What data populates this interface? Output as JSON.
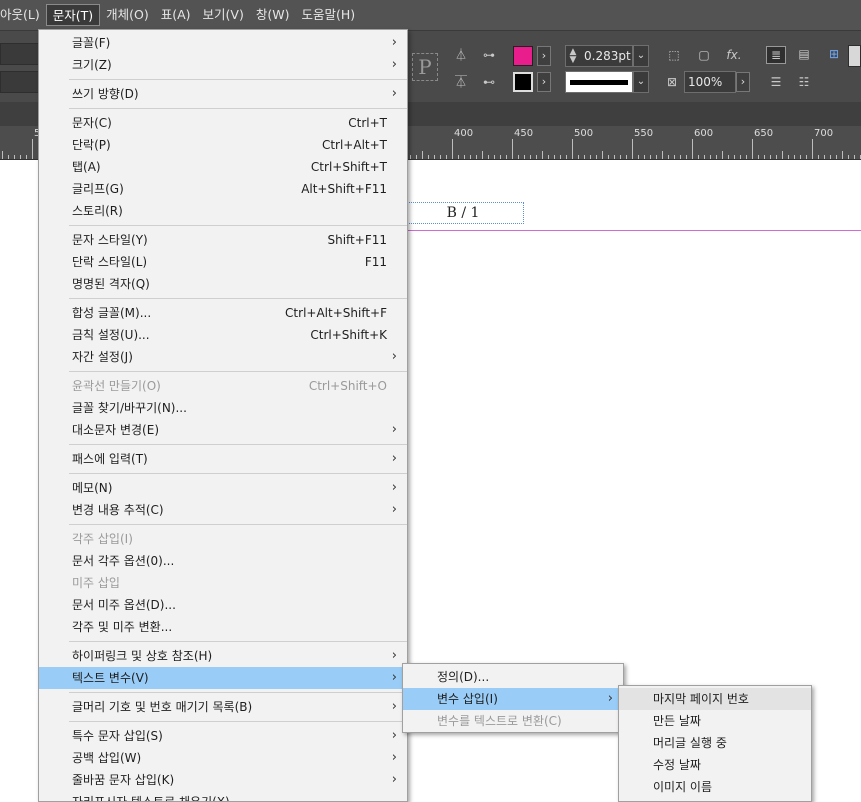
{
  "menubar": {
    "items": [
      "아웃(L)",
      "문자(T)",
      "개체(O)",
      "표(A)",
      "보기(V)",
      "창(W)",
      "도움말(H)"
    ]
  },
  "control": {
    "stroke_weight": "0.283pt",
    "opacity": "100%",
    "fill_color": "#e91e8c",
    "stroke_color": "#000000",
    "fx_label": "fx.",
    "placeholder_glyph": "P"
  },
  "ruler": {
    "labels": [
      "5",
      "400",
      "450",
      "500",
      "550",
      "600",
      "650",
      "700"
    ]
  },
  "document": {
    "page_marker": "B / 1"
  },
  "main_menu": {
    "groups": [
      [
        {
          "label": "글꼴(F)",
          "shortcut": "",
          "submenu": true,
          "disabled": false
        },
        {
          "label": "크기(Z)",
          "shortcut": "",
          "submenu": true,
          "disabled": false
        }
      ],
      [
        {
          "label": "쓰기 방향(D)",
          "shortcut": "",
          "submenu": true,
          "disabled": false
        }
      ],
      [
        {
          "label": "문자(C)",
          "shortcut": "Ctrl+T",
          "submenu": false,
          "disabled": false
        },
        {
          "label": "단락(P)",
          "shortcut": "Ctrl+Alt+T",
          "submenu": false,
          "disabled": false
        },
        {
          "label": "탭(A)",
          "shortcut": "Ctrl+Shift+T",
          "submenu": false,
          "disabled": false
        },
        {
          "label": "글리프(G)",
          "shortcut": "Alt+Shift+F11",
          "submenu": false,
          "disabled": false
        },
        {
          "label": "스토리(R)",
          "shortcut": "",
          "submenu": false,
          "disabled": false
        }
      ],
      [
        {
          "label": "문자 스타일(Y)",
          "shortcut": "Shift+F11",
          "submenu": false,
          "disabled": false
        },
        {
          "label": "단락 스타일(L)",
          "shortcut": "F11",
          "submenu": false,
          "disabled": false
        },
        {
          "label": "명명된 격자(Q)",
          "shortcut": "",
          "submenu": false,
          "disabled": false
        }
      ],
      [
        {
          "label": "합성 글꼴(M)...",
          "shortcut": "Ctrl+Alt+Shift+F",
          "submenu": false,
          "disabled": false
        },
        {
          "label": "금칙 설정(U)...",
          "shortcut": "Ctrl+Shift+K",
          "submenu": false,
          "disabled": false
        },
        {
          "label": "자간 설정(J)",
          "shortcut": "",
          "submenu": true,
          "disabled": false
        }
      ],
      [
        {
          "label": "윤곽선 만들기(O)",
          "shortcut": "Ctrl+Shift+O",
          "submenu": false,
          "disabled": true
        },
        {
          "label": "글꼴 찾기/바꾸기(N)...",
          "shortcut": "",
          "submenu": false,
          "disabled": false
        },
        {
          "label": "대소문자 변경(E)",
          "shortcut": "",
          "submenu": true,
          "disabled": false
        }
      ],
      [
        {
          "label": "패스에 입력(T)",
          "shortcut": "",
          "submenu": true,
          "disabled": false
        }
      ],
      [
        {
          "label": "메모(N)",
          "shortcut": "",
          "submenu": true,
          "disabled": false
        },
        {
          "label": "변경 내용 추적(C)",
          "shortcut": "",
          "submenu": true,
          "disabled": false
        }
      ],
      [
        {
          "label": "각주 삽입(I)",
          "shortcut": "",
          "submenu": false,
          "disabled": true
        },
        {
          "label": "문서 각주 옵션(0)...",
          "shortcut": "",
          "submenu": false,
          "disabled": false
        },
        {
          "label": "미주 삽입",
          "shortcut": "",
          "submenu": false,
          "disabled": true
        },
        {
          "label": "문서 미주 옵션(D)...",
          "shortcut": "",
          "submenu": false,
          "disabled": false
        },
        {
          "label": "각주 및 미주 변환...",
          "shortcut": "",
          "submenu": false,
          "disabled": false
        }
      ],
      [
        {
          "label": "하이퍼링크 및 상호 참조(H)",
          "shortcut": "",
          "submenu": true,
          "disabled": false
        },
        {
          "label": "텍스트 변수(V)",
          "shortcut": "",
          "submenu": true,
          "disabled": false,
          "highlighted": true
        }
      ],
      [
        {
          "label": "글머리 기호 및 번호 매기기 목록(B)",
          "shortcut": "",
          "submenu": true,
          "disabled": false
        }
      ],
      [
        {
          "label": "특수 문자 삽입(S)",
          "shortcut": "",
          "submenu": true,
          "disabled": false
        },
        {
          "label": "공백 삽입(W)",
          "shortcut": "",
          "submenu": true,
          "disabled": false
        },
        {
          "label": "줄바꿈 문자 삽입(K)",
          "shortcut": "",
          "submenu": true,
          "disabled": false
        },
        {
          "label": "자리표시자 텍스트로 채우기(X)",
          "shortcut": "",
          "submenu": false,
          "disabled": false
        }
      ]
    ]
  },
  "sub_menu": {
    "items": [
      {
        "label": "정의(D)...",
        "submenu": false,
        "disabled": false
      },
      {
        "label": "변수 삽입(I)",
        "submenu": true,
        "disabled": false,
        "highlighted": true
      },
      {
        "label": "변수를 텍스트로 변환(C)",
        "submenu": false,
        "disabled": true
      }
    ]
  },
  "subsub_menu": {
    "items": [
      {
        "label": "마지막 페이지 번호",
        "hover": true
      },
      {
        "label": "만든 날짜"
      },
      {
        "label": "머리글 실행 중"
      },
      {
        "label": "수정 날짜"
      },
      {
        "label": "이미지 이름"
      }
    ]
  }
}
